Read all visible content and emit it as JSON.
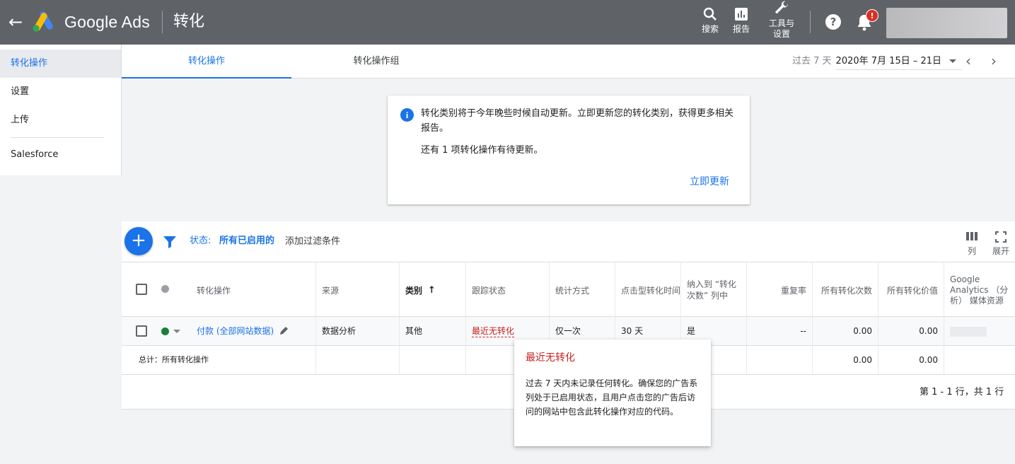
{
  "header": {
    "brand": "Google Ads",
    "page_title": "转化",
    "search_label": "搜索",
    "reports_label": "报告",
    "tools_label_line1": "工具与",
    "tools_label_line2": "设置",
    "notification_badge": "!"
  },
  "sidebar": {
    "items": [
      {
        "label": "转化操作"
      },
      {
        "label": "设置"
      },
      {
        "label": "上传"
      },
      {
        "label": "Salesforce"
      }
    ]
  },
  "tabs": [
    {
      "label": "转化操作"
    },
    {
      "label": "转化操作组"
    }
  ],
  "date_range": {
    "label": "过去 7 天",
    "value": "2020年 7月 15日 – 21日"
  },
  "notice": {
    "message": "转化类别将于今年晚些时候自动更新。立即更新您的转化类别，获得更多相关报告。",
    "pending": "还有 1 项转化操作有待更新。",
    "action": "立即更新"
  },
  "filters": {
    "status_label": "状态:",
    "status_value": "所有已启用的",
    "add_filter": "添加过滤条件"
  },
  "toolbar": {
    "columns_label": "列",
    "expand_label": "展开"
  },
  "table": {
    "headers": {
      "name": "转化操作",
      "source": "来源",
      "category": "类别",
      "tracking": "跟踪状态",
      "counting": "统计方式",
      "click_window": "点击型转化时间",
      "include": "纳入到 “转化次数” 列中",
      "repeat_rate": "重复率",
      "all_conv": "所有转化次数",
      "all_conv_value": "所有转化价值",
      "ga": "Google Analytics （分析） 媒体资源"
    },
    "row": {
      "name": "付款 (全部网站数据)",
      "source": "数据分析",
      "category": "其他",
      "tracking": "最近无转化",
      "counting": "仅一次",
      "click_window": "30 天",
      "include": "是",
      "repeat_rate": "--",
      "all_conv": "0.00",
      "all_conv_value": "0.00"
    },
    "total": {
      "label": "总计：所有转化操作",
      "all_conv": "0.00",
      "all_conv_value": "0.00"
    },
    "pagination": "第 1 - 1 行，共 1 行"
  },
  "tooltip": {
    "title": "最近无转化",
    "body": "过去 7 天内未记录任何转化。确保您的广告系列处于已启用状态，且用户点击您的广告后访问的网站中包含此转化操作对应的代码。"
  },
  "colors": {
    "header_bg": "#5f6368",
    "accent": "#1a73e8",
    "error": "#c5221f",
    "status_enabled": "#188038"
  }
}
